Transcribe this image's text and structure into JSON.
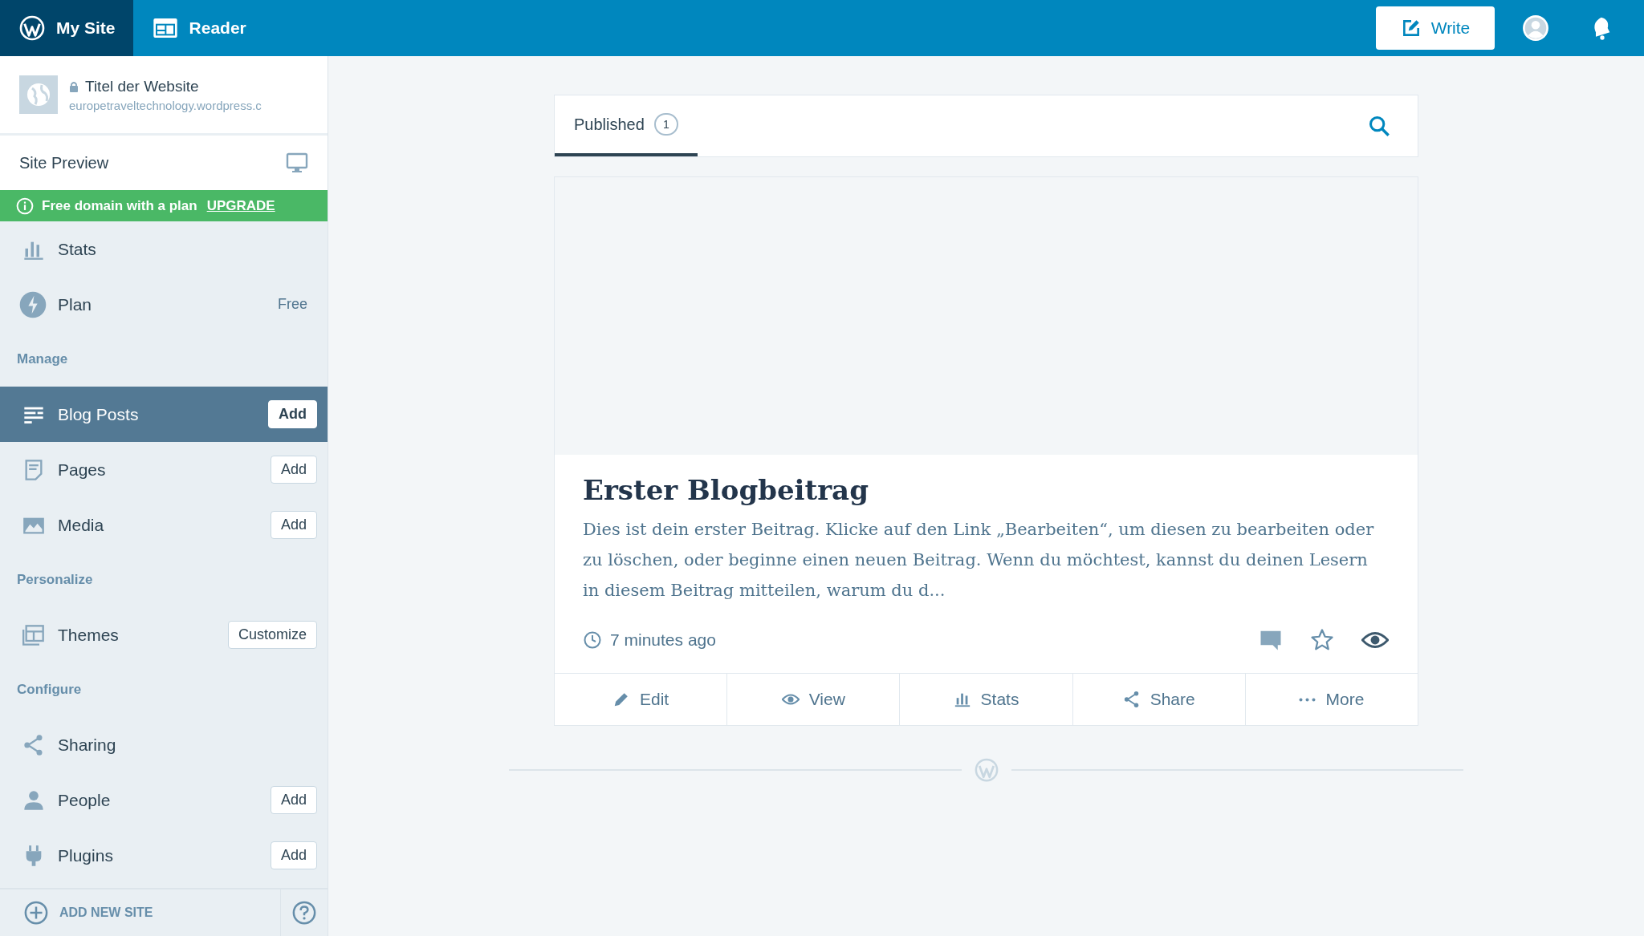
{
  "masterbar": {
    "tabs": [
      {
        "label": "My Site",
        "selected": true
      },
      {
        "label": "Reader",
        "selected": false
      }
    ],
    "write_button": "Write"
  },
  "site": {
    "title": "Titel der Website",
    "url": "europetraveltechnology.wordpress.c"
  },
  "site_preview": "Site Preview",
  "banner": {
    "text": "Free domain with a plan",
    "link": "UPGRADE"
  },
  "sidebar": {
    "sections": [
      {
        "items": [
          {
            "label": "Stats",
            "selected": false
          },
          {
            "label": "Plan",
            "value": "Free",
            "selected": false
          }
        ]
      },
      {
        "heading": "Manage",
        "items": [
          {
            "label": "Blog Posts",
            "action": "Add",
            "selected": true
          },
          {
            "label": "Pages",
            "action": "Add",
            "selected": false
          },
          {
            "label": "Media",
            "action": "Add",
            "selected": false
          }
        ]
      },
      {
        "heading": "Personalize",
        "items": [
          {
            "label": "Themes",
            "action": "Customize",
            "selected": false
          }
        ]
      },
      {
        "heading": "Configure",
        "items": [
          {
            "label": "Sharing",
            "selected": false
          },
          {
            "label": "People",
            "action": "Add",
            "selected": false
          },
          {
            "label": "Plugins",
            "action": "Add",
            "selected": false
          }
        ]
      }
    ],
    "footer": "ADD NEW SITE"
  },
  "tabs": [
    {
      "label": "Published",
      "count": "1",
      "selected": true
    }
  ],
  "post": {
    "title": "Erster Blogbeitrag",
    "excerpt": "Dies ist dein erster Beitrag. Klicke auf den Link „Bearbeiten“, um diesen zu bearbeiten oder zu löschen, oder beginne einen neuen Beitrag. Wenn du möchtest, kannst du deinen Lesern in diesem Beitrag mitteilen, warum du d...",
    "time": "7 minutes ago",
    "actions": [
      "Edit",
      "View",
      "Stats",
      "Share",
      "More"
    ]
  }
}
